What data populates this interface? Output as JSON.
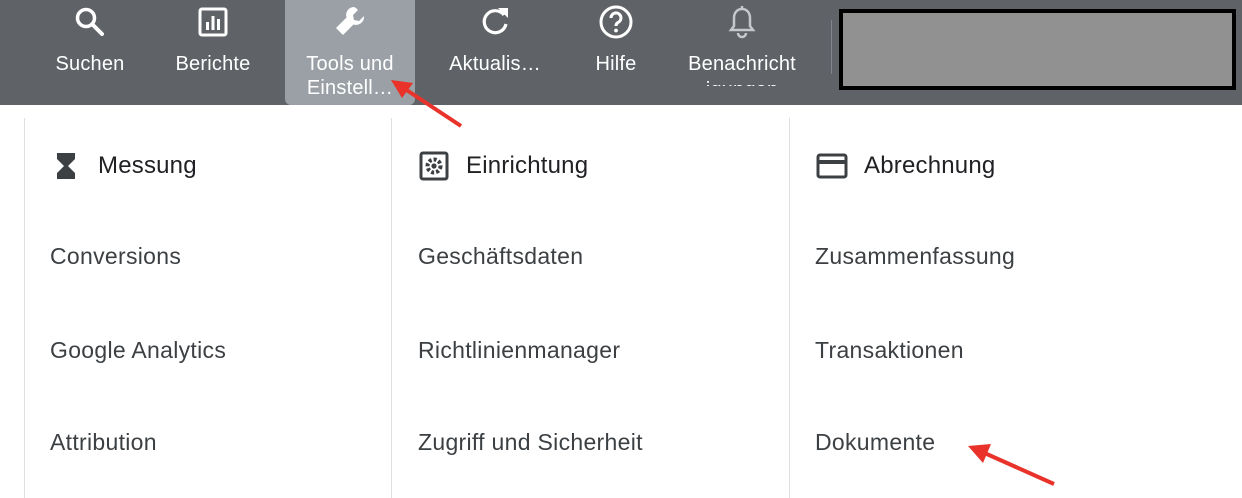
{
  "toolbar": {
    "items": [
      {
        "label": "Suchen",
        "icon": "search-icon"
      },
      {
        "label": "Berichte",
        "icon": "reports-icon"
      },
      {
        "label_line1": "Tools und",
        "label_line2": "Einstell…",
        "icon": "wrench-icon",
        "active": true
      },
      {
        "label": "Aktualis…",
        "icon": "refresh-icon"
      },
      {
        "label": "Hilfe",
        "icon": "help-icon"
      },
      {
        "label_line1": "Benachricht",
        "label_line2": "igungen",
        "icon": "bell-icon"
      }
    ],
    "background": "#5f6368",
    "active_background": "#9aa0a6"
  },
  "menu": {
    "columns": [
      {
        "heading": "Messung",
        "icon": "hourglass-icon",
        "items": [
          "Conversions",
          "Google Analytics",
          "Attribution"
        ]
      },
      {
        "heading": "Einrichtung",
        "icon": "settings-box-icon",
        "items": [
          "Geschäftsdaten",
          "Richtlinienmanager",
          "Zugriff und Sicherheit"
        ]
      },
      {
        "heading": "Abrechnung",
        "icon": "credit-card-icon",
        "items": [
          "Zusammenfassung",
          "Transaktionen",
          "Dokumente"
        ]
      }
    ]
  },
  "annotation_color": "#e8322a"
}
